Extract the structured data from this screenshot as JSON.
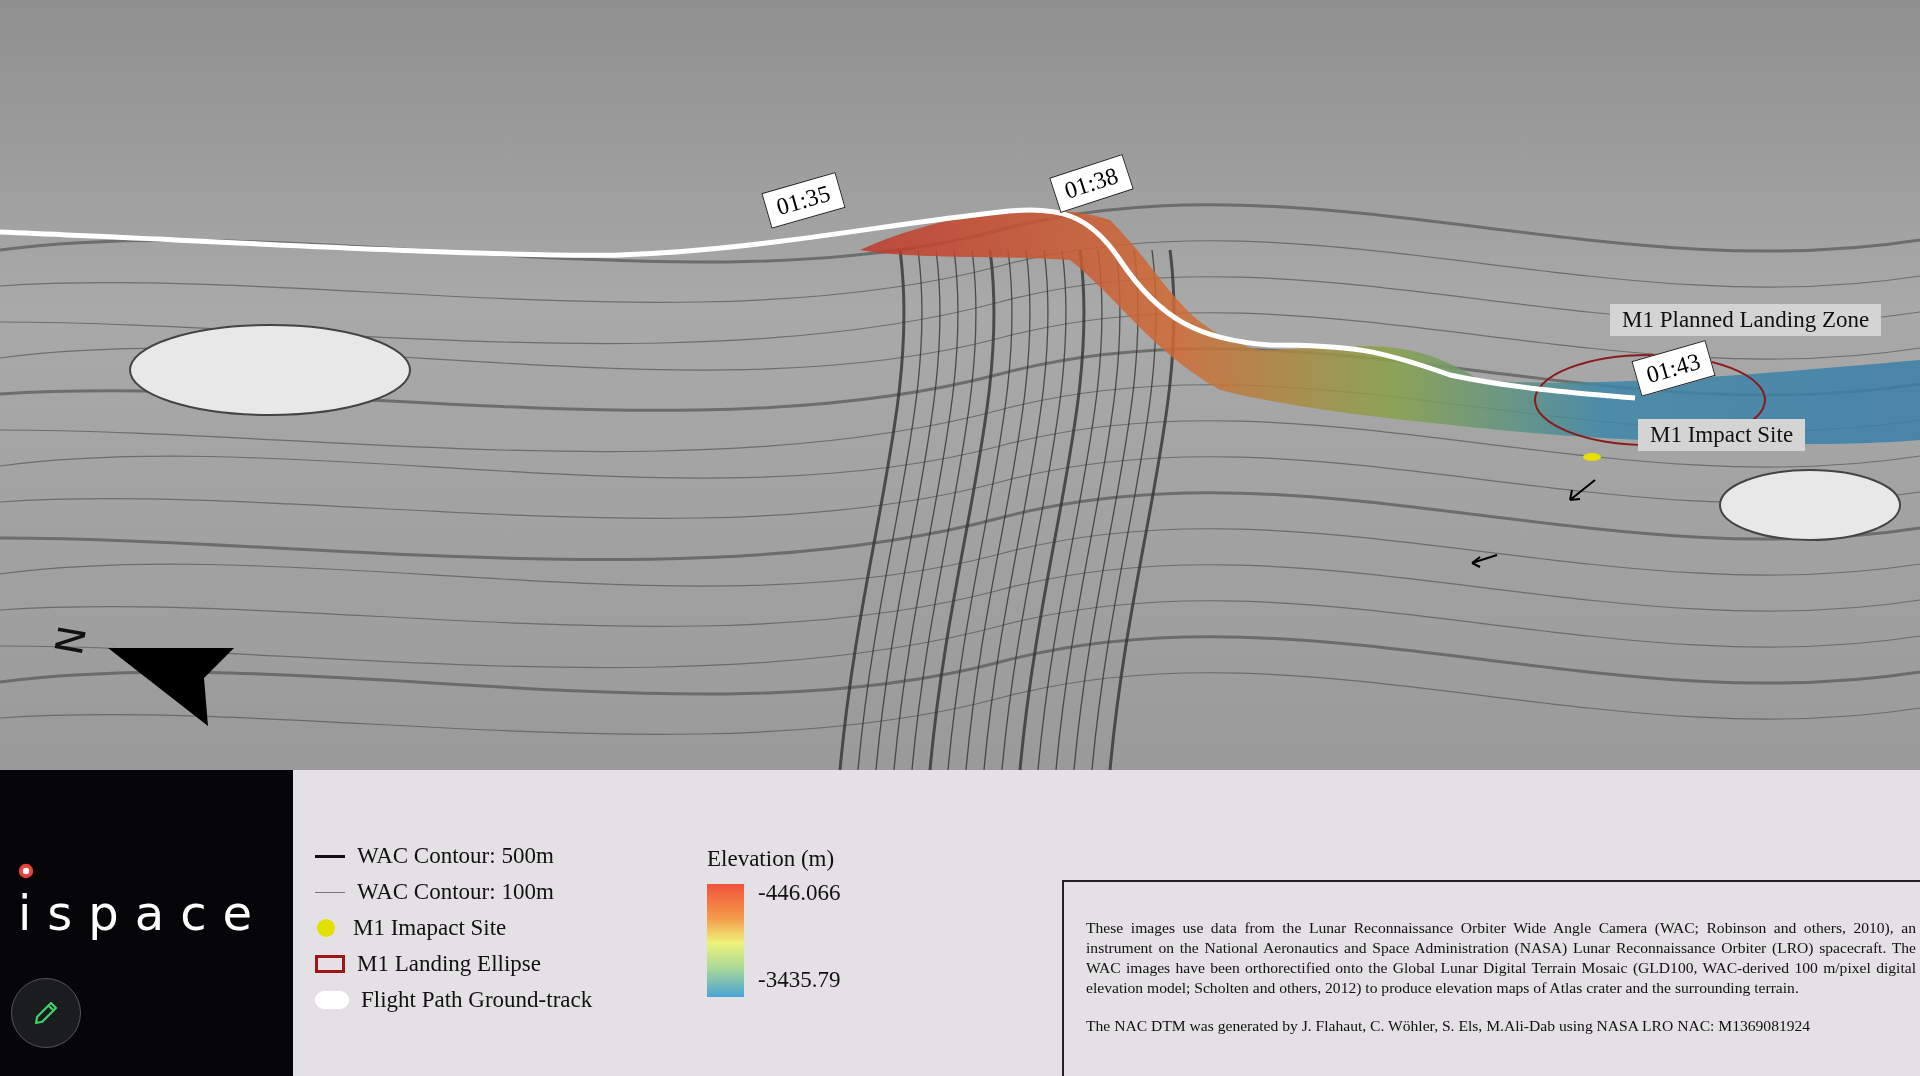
{
  "map": {
    "time_labels": [
      "01:35",
      "01:38",
      "01:43"
    ],
    "place_labels": [
      "M1 Planned Landing Zone",
      "M1 Impact Site"
    ],
    "north_label": "N"
  },
  "logo": "ispace",
  "legend": {
    "items": [
      {
        "kind": "thick-line",
        "label": "WAC Contour: 500m"
      },
      {
        "kind": "thin-line",
        "label": "WAC Contour: 100m"
      },
      {
        "kind": "dot",
        "label": "M1 Imapact Site"
      },
      {
        "kind": "outline",
        "label": "M1 Landing Ellipse"
      },
      {
        "kind": "track",
        "label": "Flight Path Ground-track"
      }
    ]
  },
  "elevation": {
    "title": "Elevation (m)",
    "max": "-446.066",
    "min": "-3435.79"
  },
  "credits": [
    "These images use data from the Lunar Reconnaissance Orbiter Wide Angle Camera (WAC; Robinson and others, 2010), an instrument on the National Aeronautics and Space Administration (NASA) Lunar Reconnaissance Orbiter (LRO) spacecraft. The WAC images have been orthorectified onto the Global Lunar Digital Terrain Mosaic (GLD100, WAC-derived 100 m/pixel digital elevation model; Scholten and others, 2012) to produce elevation maps of Atlas crater and the surrounding terrain.",
    "The NAC DTM was generated by J. Flahaut, C. Wöhler, S. Els, M.Ali-Dab using NASA LRO NAC: M1369081924"
  ]
}
